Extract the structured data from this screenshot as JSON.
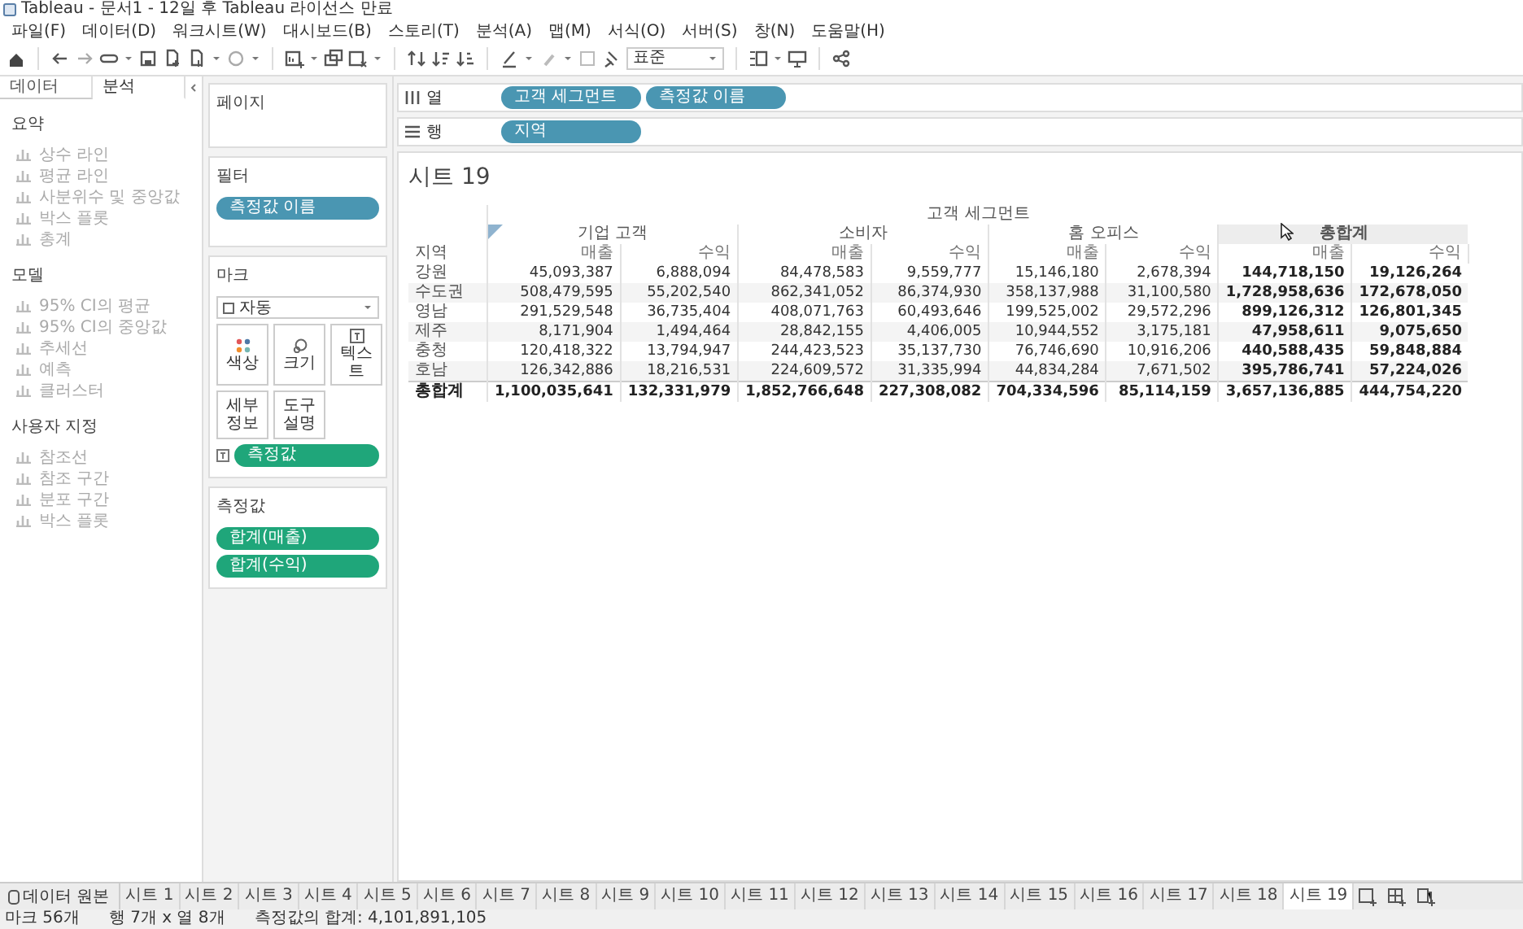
{
  "window": {
    "title": "Tableau - 문서1 - 12일 후 Tableau 라이선스 만료"
  },
  "menu": [
    "파일(F)",
    "데이터(D)",
    "워크시트(W)",
    "대시보드(B)",
    "스토리(T)",
    "분석(A)",
    "맵(M)",
    "서식(O)",
    "서버(S)",
    "창(N)",
    "도움말(H)"
  ],
  "toolbar": {
    "fit_select": "표준"
  },
  "left_panel": {
    "tabs": [
      {
        "label": "데이터",
        "selected": false
      },
      {
        "label": "분석",
        "selected": true
      }
    ],
    "sections": [
      {
        "title": "요약",
        "items": [
          {
            "label": "상수 라인",
            "disabled": true
          },
          {
            "label": "평균 라인",
            "disabled": true
          },
          {
            "label": "사분위수 및 중앙값",
            "disabled": true
          },
          {
            "label": "박스 플롯",
            "disabled": true
          },
          {
            "label": "총계",
            "disabled": true
          }
        ]
      },
      {
        "title": "모델",
        "items": [
          {
            "label": "95% CI의 평균",
            "disabled": true
          },
          {
            "label": "95% CI의 중앙값",
            "disabled": true
          },
          {
            "label": "추세선",
            "disabled": true
          },
          {
            "label": "예측",
            "disabled": true
          },
          {
            "label": "클러스터",
            "disabled": true
          }
        ]
      },
      {
        "title": "사용자 지정",
        "items": [
          {
            "label": "참조선",
            "disabled": true
          },
          {
            "label": "참조 구간",
            "disabled": true
          },
          {
            "label": "분포 구간",
            "disabled": true
          },
          {
            "label": "박스 플롯",
            "disabled": true
          }
        ]
      }
    ]
  },
  "pages_card": {
    "title": "페이지"
  },
  "filters_card": {
    "title": "필터",
    "pills": [
      {
        "label": "측정값 이름",
        "kind": "dimension"
      }
    ]
  },
  "marks_card": {
    "title": "마크",
    "mark_type": "자동",
    "buttons": [
      {
        "label": "색상",
        "kind": "color"
      },
      {
        "label": "크기",
        "kind": "size"
      },
      {
        "label": "텍스트",
        "kind": "text"
      },
      {
        "label": "세부 정보",
        "kind": "detail"
      },
      {
        "label": "도구 설명",
        "kind": "tooltip"
      }
    ],
    "pills": [
      {
        "label": "측정값",
        "kind": "measure"
      }
    ]
  },
  "measures_card": {
    "title": "측정값",
    "pills": [
      {
        "label": "합계(매출)",
        "kind": "measure"
      },
      {
        "label": "합계(수익)",
        "kind": "measure"
      }
    ]
  },
  "columns_shelf": {
    "label": "열",
    "pills": [
      {
        "label": "고객 세그먼트",
        "kind": "dimension"
      },
      {
        "label": "측정값 이름",
        "kind": "dimension"
      }
    ]
  },
  "rows_shelf": {
    "label": "행",
    "pills": [
      {
        "label": "지역",
        "kind": "dimension"
      }
    ]
  },
  "sheet": {
    "title": "시트 19",
    "table": {
      "header": "고객 세그먼트",
      "row_header": "지역",
      "segments": [
        {
          "label": "기업 고객",
          "total": false,
          "highlighted": false
        },
        {
          "label": "소비자",
          "total": false,
          "highlighted": false
        },
        {
          "label": "홈 오피스",
          "total": false,
          "highlighted": false
        },
        {
          "label": "총합계",
          "total": true,
          "highlighted": true
        }
      ],
      "measures": [
        "매출",
        "수익",
        "매출",
        "수익",
        "매출",
        "수익",
        "매출",
        "수익"
      ],
      "rows": [
        {
          "label": "강원",
          "total": false,
          "values": [
            "45,093,387",
            "6,888,094",
            "84,478,583",
            "9,559,777",
            "15,146,180",
            "2,678,394",
            "144,718,150",
            "19,126,264"
          ]
        },
        {
          "label": "수도권",
          "total": false,
          "values": [
            "508,479,595",
            "55,202,540",
            "862,341,052",
            "86,374,930",
            "358,137,988",
            "31,100,580",
            "1,728,958,636",
            "172,678,050"
          ]
        },
        {
          "label": "영남",
          "total": false,
          "values": [
            "291,529,548",
            "36,735,404",
            "408,071,763",
            "60,493,646",
            "199,525,002",
            "29,572,296",
            "899,126,312",
            "126,801,345"
          ]
        },
        {
          "label": "제주",
          "total": false,
          "values": [
            "8,171,904",
            "1,494,464",
            "28,842,155",
            "4,406,005",
            "10,944,552",
            "3,175,181",
            "47,958,611",
            "9,075,650"
          ]
        },
        {
          "label": "충청",
          "total": false,
          "values": [
            "120,418,322",
            "13,794,947",
            "244,423,523",
            "35,137,730",
            "76,746,690",
            "10,916,206",
            "440,588,435",
            "59,848,884"
          ]
        },
        {
          "label": "호남",
          "total": false,
          "values": [
            "126,342,886",
            "18,216,531",
            "224,609,572",
            "31,335,994",
            "44,834,284",
            "7,671,502",
            "395,786,741",
            "57,224,026"
          ]
        },
        {
          "label": "총합계",
          "total": true,
          "values": [
            "1,100,035,641",
            "132,331,979",
            "1,852,766,648",
            "227,308,082",
            "704,334,596",
            "85,114,159",
            "3,657,136,885",
            "444,754,220"
          ]
        }
      ]
    }
  },
  "data_source_tab": "데이터 원본",
  "sheet_tabs": [
    {
      "label": "시트 1",
      "selected": false
    },
    {
      "label": "시트 2",
      "selected": false
    },
    {
      "label": "시트 3",
      "selected": false
    },
    {
      "label": "시트 4",
      "selected": false
    },
    {
      "label": "시트 5",
      "selected": false
    },
    {
      "label": "시트 6",
      "selected": false
    },
    {
      "label": "시트 7",
      "selected": false
    },
    {
      "label": "시트 8",
      "selected": false
    },
    {
      "label": "시트 9",
      "selected": false
    },
    {
      "label": "시트 10",
      "selected": false
    },
    {
      "label": "시트 11",
      "selected": false
    },
    {
      "label": "시트 12",
      "selected": false
    },
    {
      "label": "시트 13",
      "selected": false
    },
    {
      "label": "시트 14",
      "selected": false
    },
    {
      "label": "시트 15",
      "selected": false
    },
    {
      "label": "시트 16",
      "selected": false
    },
    {
      "label": "시트 17",
      "selected": false
    },
    {
      "label": "시트 18",
      "selected": false
    },
    {
      "label": "시트 19",
      "selected": true
    }
  ],
  "status_bar": [
    "마크 56개",
    "행 7개 x 열 8개",
    "측정값의 합계: 4,101,891,105"
  ]
}
